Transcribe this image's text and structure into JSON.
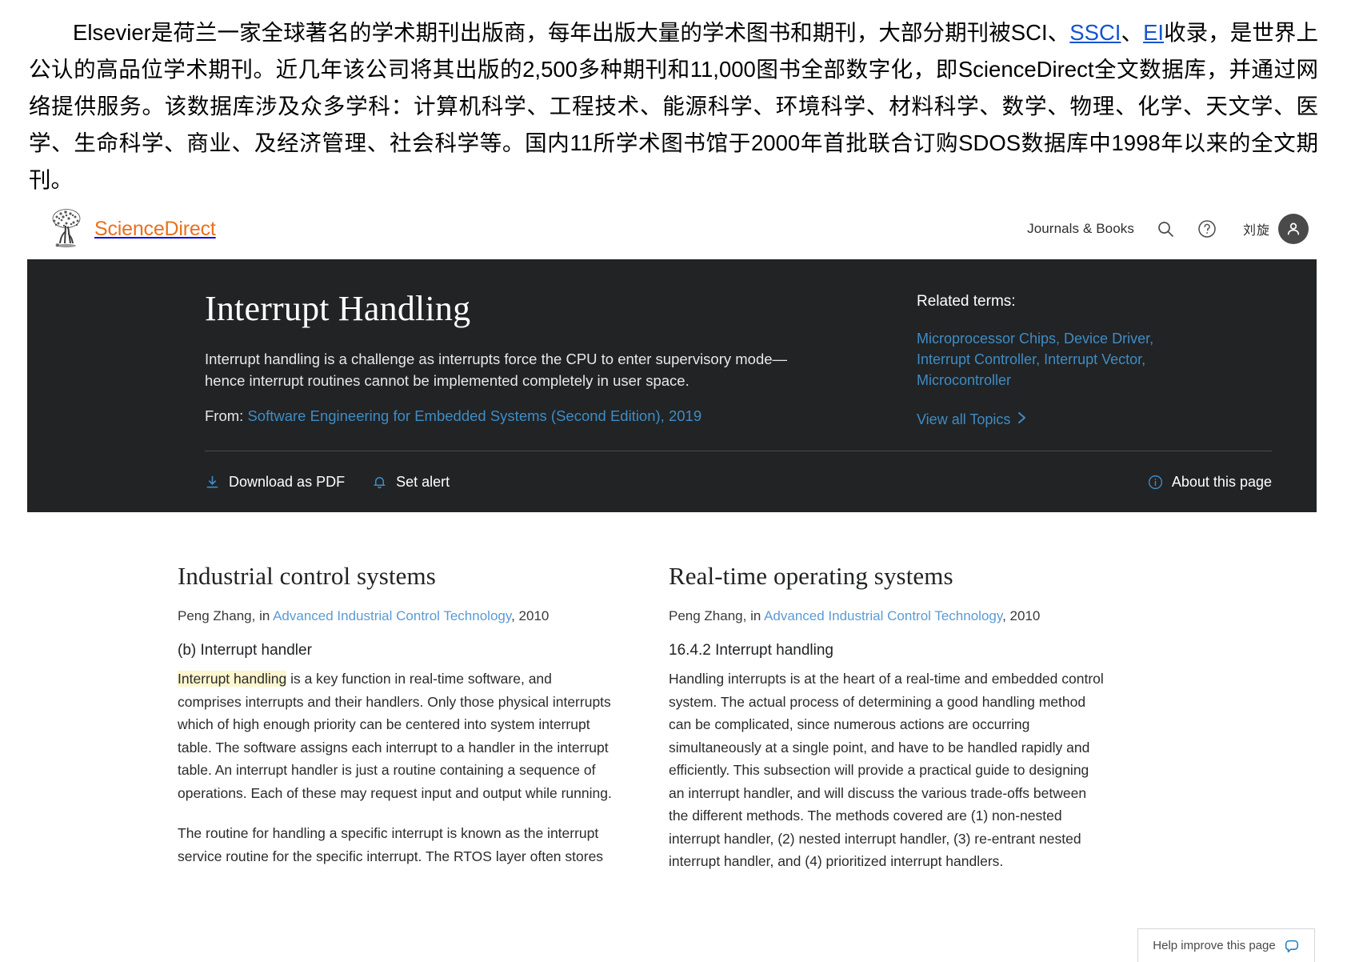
{
  "intro": {
    "text_parts": [
      {
        "t": "Elsevier是荷兰一家全球著名的学术期刊出版商，每年出版大量的学术图书和期刊，大部分期刊被SCI、",
        "link": false
      },
      {
        "t": "SSCI",
        "link": true
      },
      {
        "t": "、",
        "link": false
      },
      {
        "t": "EI",
        "link": true
      },
      {
        "t": "收录，是世界上公认的高品位学术期刊。近几年该公司将其出版的2,500多种期刊和11,000图书全部数字化，即ScienceDirect全文数据库，并通过网络提供服务。该数据库涉及众多学科：计算机科学、工程技术、能源科学、环境科学、材料科学、数学、物理、化学、天文学、医学、生命科学、商业、及经济管理、社会科学等。国内11所学术图书馆于2000年首批联合订购SDOS数据库中1998年以来的全文期刊。",
        "link": false
      }
    ],
    "link_color": "#1454d0"
  },
  "header": {
    "brand_name": "ScienceDirect",
    "brand_color": "#e9711c",
    "nav_journals_books": "Journals & Books",
    "search_icon": "search-icon",
    "help_icon": "question-circle-icon",
    "user_name": "刘旋",
    "avatar_icon": "user-icon"
  },
  "hero": {
    "background": "#212325",
    "title": "Interrupt Handling",
    "description": "Interrupt handling is a challenge as interrupts force the CPU to enter supervisory mode—hence interrupt routines cannot be implemented completely in user space.",
    "from_label": "From:",
    "from_link": "Software Engineering for Embedded Systems (Second Edition), 2019",
    "related_label": "Related terms:",
    "related_terms": "Microprocessor Chips, Device Driver, Interrupt Controller, Interrupt Vector, Microcontroller",
    "view_all_topics": "View all Topics",
    "chevron_icon": "chevron-right-icon",
    "actions": {
      "download_label": "Download as PDF",
      "download_icon": "download-icon",
      "alert_label": "Set alert",
      "alert_icon": "bell-icon",
      "about_label": "About this page",
      "about_icon": "info-circle-icon"
    },
    "link_color": "#3f8cc4"
  },
  "columns": [
    {
      "title": "Industrial control systems",
      "byline_author": "Peng Zhang, in ",
      "byline_link": "Advanced Industrial Control Technology",
      "byline_year": ", 2010",
      "subheading": "(b) Interrupt handler",
      "para1_highlight": "Interrupt handling",
      "para1_rest": " is a key function in real-time software, and comprises interrupts and their handlers. Only those physical interrupts which of high enough priority can be centered into system interrupt table. The software assigns each interrupt to a handler in the interrupt table. An interrupt handler is just a routine containing a sequence of operations. Each of these may request input and output while running.",
      "para2": "The routine for handling a specific interrupt is known as the interrupt service routine for the specific interrupt. The RTOS layer often stores"
    },
    {
      "title": "Real-time operating systems",
      "byline_author": "Peng Zhang, in ",
      "byline_link": "Advanced Industrial Control Technology",
      "byline_year": ", 2010",
      "subheading": "16.4.2 Interrupt handling",
      "para1_highlight": "",
      "para1_rest": "Handling interrupts is at the heart of a real-time and embedded control system. The actual process of determining a good handling method can be complicated, since numerous actions are occurring simultaneously at a single point, and have to be handled rapidly and efficiently. This subsection will provide a practical guide to designing an interrupt handler, and will discuss the various trade-offs between the different methods. The methods covered are (1) non-nested interrupt handler, (2) nested interrupt handler, (3) re-entrant nested interrupt handler, and (4) prioritized interrupt handlers.",
      "para2": ""
    }
  ],
  "help_widget": {
    "label": "Help improve this page",
    "icon": "speech-bubble-icon"
  }
}
